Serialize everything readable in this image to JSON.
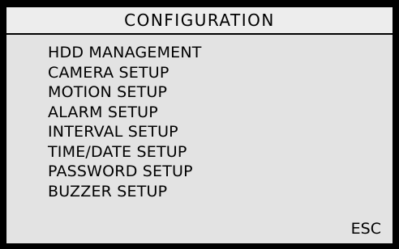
{
  "header": {
    "title": "CONFIGURATION"
  },
  "menu": {
    "items": [
      {
        "label": "HDD MANAGEMENT"
      },
      {
        "label": "CAMERA SETUP"
      },
      {
        "label": "MOTION SETUP"
      },
      {
        "label": "ALARM SETUP"
      },
      {
        "label": "INTERVAL SETUP"
      },
      {
        "label": "TIME/DATE SETUP"
      },
      {
        "label": "PASSWORD SETUP"
      },
      {
        "label": "BUZZER SETUP"
      }
    ]
  },
  "footer": {
    "esc_label": "ESC"
  },
  "colors": {
    "background": "#e3e3e3",
    "frame": "#000000",
    "text": "#000000"
  }
}
